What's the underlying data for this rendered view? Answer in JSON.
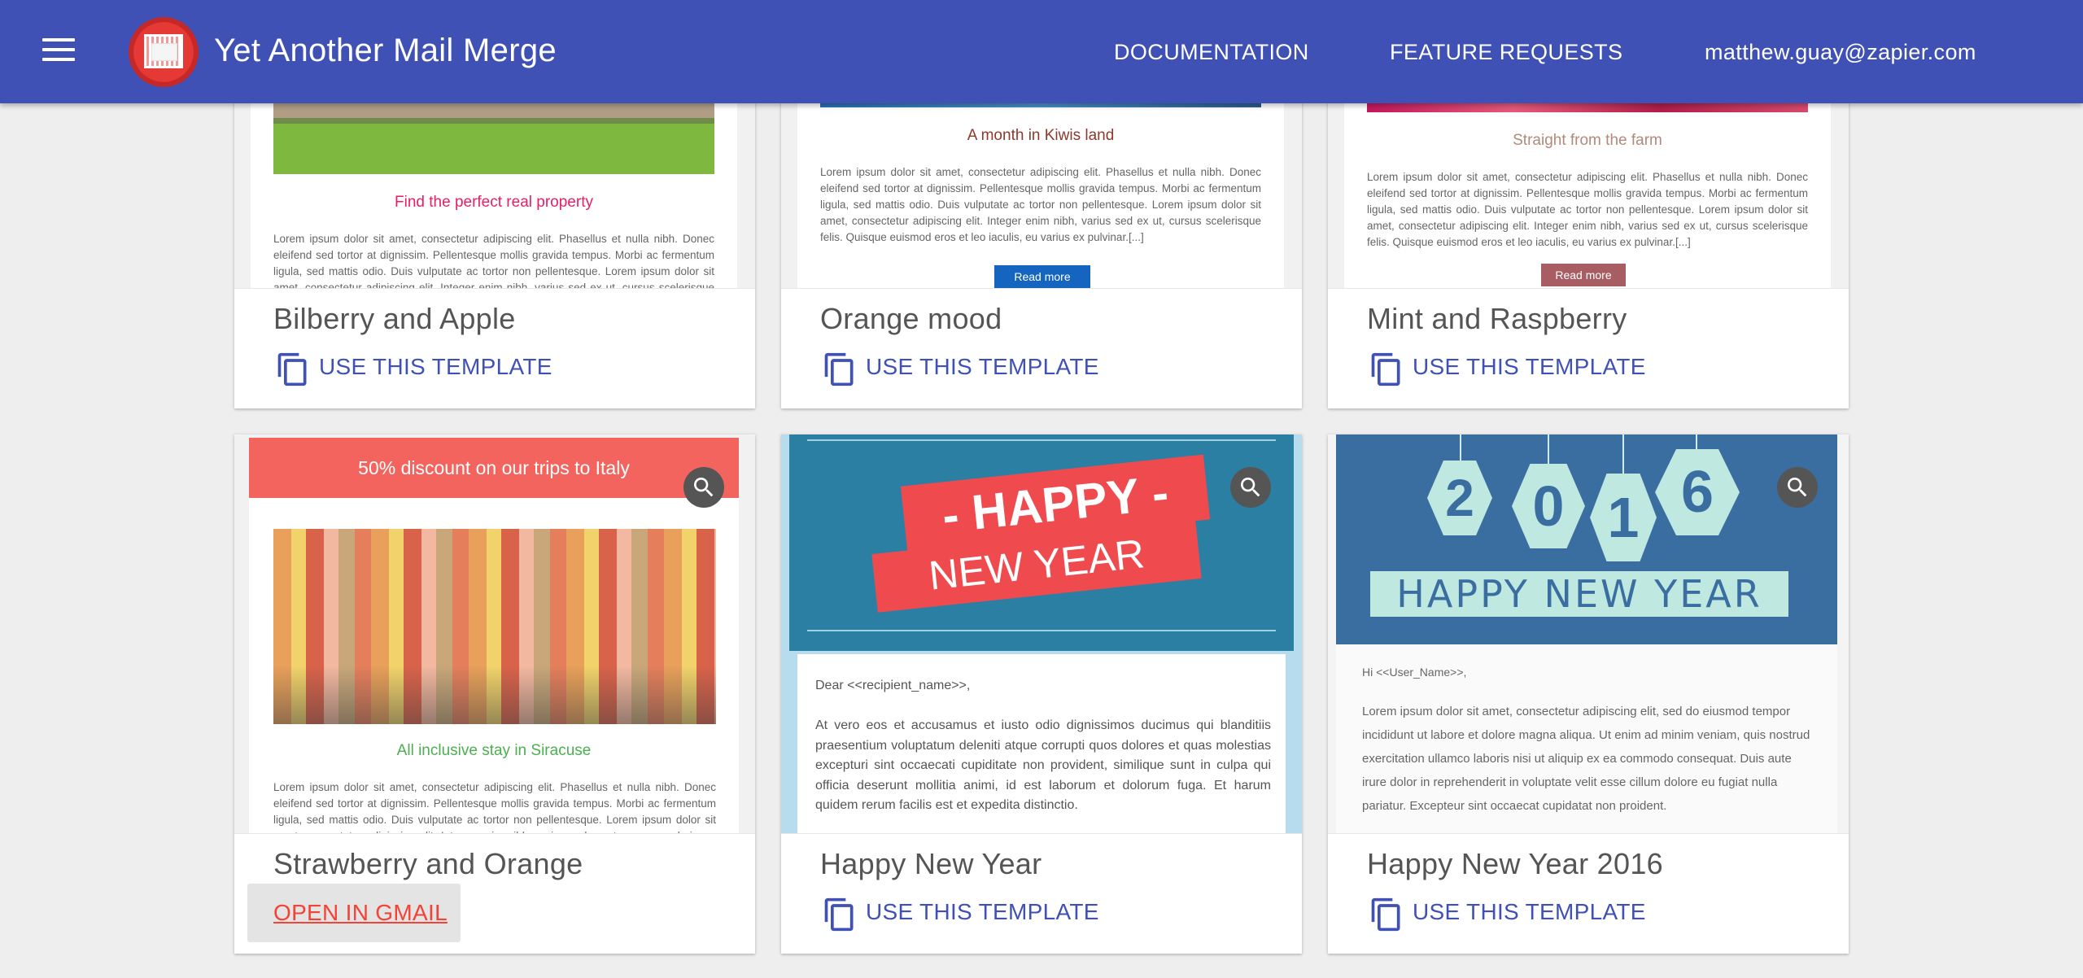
{
  "app": {
    "title": "Yet Another Mail Merge",
    "accent": "#3f51b5",
    "nav": {
      "documentation": "DOCUMENTATION",
      "feature_requests": "FEATURE REQUESTS",
      "user_email": "matthew.guay@zapier.com"
    }
  },
  "action_label": "USE THIS TEMPLATE",
  "open_in_gmail": "OPEN IN GMAIL",
  "lorem": "Lorem ipsum dolor sit amet, consectetur adipiscing elit. Phasellus et nulla nibh. Donec eleifend sed tortor at dignissim. Pellentesque mollis gravida tempus. Morbi ac fermentum ligula, sed mattis odio. Duis vulputate ac tortor non pellentesque. Lorem ipsum dolor sit amet, consectetur adipiscing elit. Integer enim nibh, varius sed ex ut, cursus scelerisque felis. Quisque euismod eros et leo iaculis, eu varius ex pulvinar.[...]",
  "templates": [
    {
      "name": "Bilberry and Apple",
      "preview": {
        "subheading": "Find the perfect real property",
        "accent": "#e91e63"
      }
    },
    {
      "name": "Orange mood",
      "preview": {
        "subheading": "A month in Kiwis land",
        "button": "Read more",
        "accent": "#8d3a2a",
        "button_color": "#1565c0"
      }
    },
    {
      "name": "Mint and Raspberry",
      "preview": {
        "subheading": "Straight from the farm",
        "button": "Read more",
        "accent": "#b08a7a",
        "button_color": "#a85d63"
      }
    },
    {
      "name": "Strawberry and Orange",
      "preview": {
        "banner": "50% discount on our trips to Italy",
        "subheading": "All inclusive stay in Siracuse",
        "accent": "#4caf50",
        "banner_color": "#f4645e"
      }
    },
    {
      "name": "Happy New Year",
      "preview": {
        "line1": "- HAPPY -",
        "line2": "NEW YEAR",
        "greeting": "Dear <<recipient_name>>,",
        "body": "At vero eos et accusamus et iusto odio dignissimos ducimus qui blanditiis praesentium voluptatum deleniti atque corrupti quos dolores et quas molestias excepturi sint occaecati cupiditate non provident, similique sunt in culpa qui officia deserunt mollitia animi, id est laborum et dolorum fuga. Et harum quidem rerum facilis est et expedita distinctio.",
        "bg_color": "#2b7fa3",
        "ribbon_color": "#ef4b4f"
      }
    },
    {
      "name": "Happy New Year 2016",
      "preview": {
        "digits": [
          "2",
          "0",
          "1",
          "6"
        ],
        "headline": "HAPPY NEW YEAR",
        "greeting": "Hi <<User_Name>>,",
        "body": "Lorem ipsum dolor sit amet, consectetur adipiscing elit, sed do eiusmod tempor incididunt ut labore et dolore magna aliqua. Ut enim ad minim veniam, quis nostrud exercitation ullamco laboris nisi ut aliquip ex ea commodo consequat. Duis aute irure dolor in reprehenderit in voluptate velit esse cillum dolore eu fugiat nulla pariatur. Excepteur sint occaecat cupidatat non proident.",
        "bg_color": "#3a6ea0",
        "tag_color": "#bfe8e0"
      }
    }
  ]
}
